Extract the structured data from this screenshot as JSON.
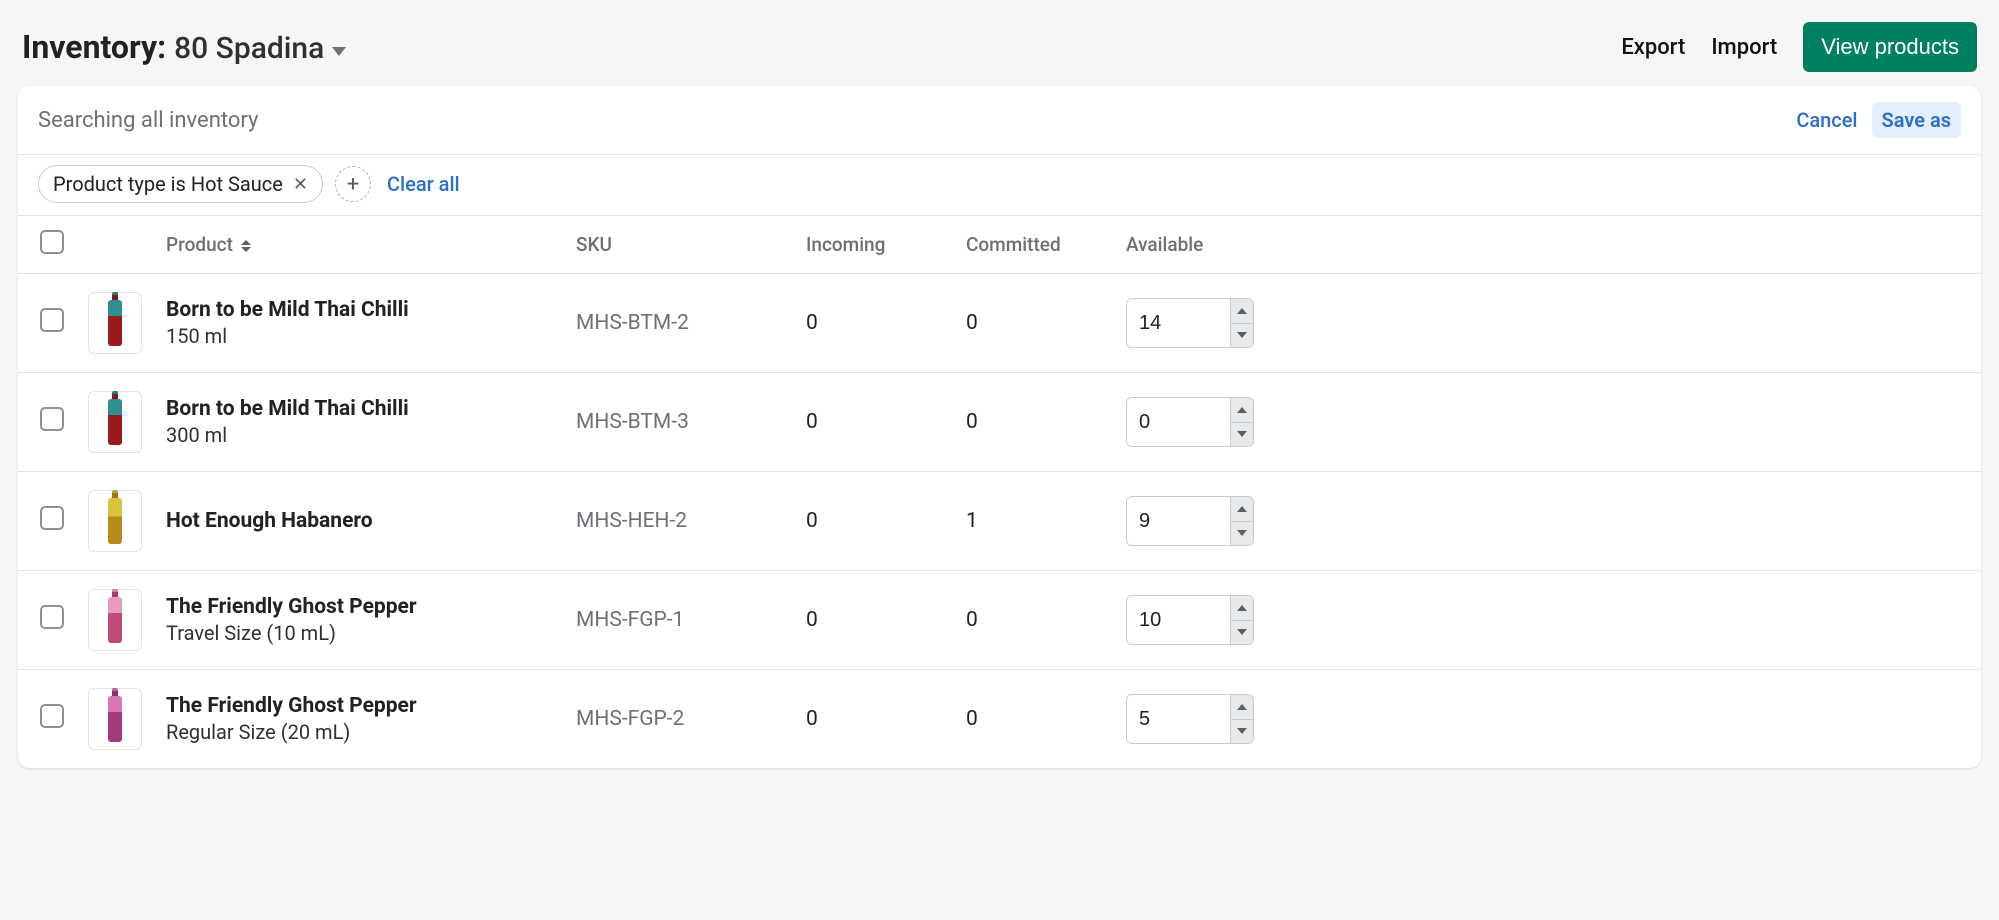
{
  "header": {
    "title": "Inventory:",
    "location": "80 Spadina",
    "export": "Export",
    "import": "Import",
    "view_products": "View products"
  },
  "card": {
    "search_text": "Searching all inventory",
    "cancel": "Cancel",
    "save_as": "Save as"
  },
  "filters": {
    "chip_label": "Product type is Hot Sauce",
    "clear_all": "Clear all"
  },
  "columns": {
    "product": "Product",
    "sku": "SKU",
    "incoming": "Incoming",
    "committed": "Committed",
    "available": "Available"
  },
  "rows": [
    {
      "name": "Born to be Mild Thai Chilli",
      "variant": "150 ml",
      "sku": "MHS-BTM-2",
      "incoming": "0",
      "committed": "0",
      "available": "14",
      "bottle": "bot-teal"
    },
    {
      "name": "Born to be Mild Thai Chilli",
      "variant": "300 ml",
      "sku": "MHS-BTM-3",
      "incoming": "0",
      "committed": "0",
      "available": "0",
      "bottle": "bot-teal"
    },
    {
      "name": "Hot Enough Habanero",
      "variant": "",
      "sku": "MHS-HEH-2",
      "incoming": "0",
      "committed": "1",
      "available": "9",
      "bottle": "bot-yellow"
    },
    {
      "name": "The Friendly Ghost Pepper",
      "variant": "Travel Size (10 mL)",
      "sku": "MHS-FGP-1",
      "incoming": "0",
      "committed": "0",
      "available": "10",
      "bottle": "bot-pink"
    },
    {
      "name": "The Friendly Ghost Pepper",
      "variant": "Regular Size (20 mL)",
      "sku": "MHS-FGP-2",
      "incoming": "0",
      "committed": "0",
      "available": "5",
      "bottle": "bot-magenta"
    }
  ]
}
